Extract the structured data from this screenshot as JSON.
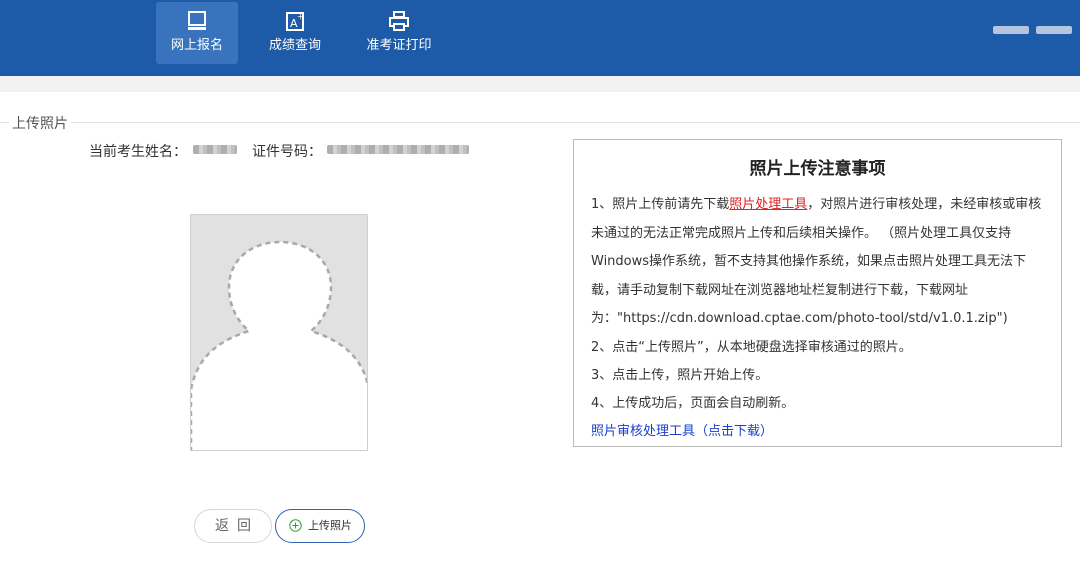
{
  "nav": {
    "items": [
      {
        "label": "网上报名",
        "icon": "monitor-icon",
        "active": true
      },
      {
        "label": "成绩查询",
        "icon": "score-document-icon",
        "active": false
      },
      {
        "label": "准考证打印",
        "icon": "printer-icon",
        "active": false
      }
    ]
  },
  "section": {
    "title": "上传照片"
  },
  "candidate": {
    "name_label": "当前考生姓名：",
    "id_label": "证件号码："
  },
  "photo": {
    "icon": "person-silhouette-icon"
  },
  "notice": {
    "title": "照片上传注意事项",
    "p1_prefix": "1、照片上传前请先下载",
    "p1_link": "照片处理工具",
    "p1_suffix": "，对照片进行审核处理，未经审核或审核未通过的无法正常完成照片上传和后续相关操作。 （照片处理工具仅支持Windows操作系统，暂不支持其他操作系统，如果点击照片处理工具无法下载，请手动复制下载网址在浏览器地址栏复制进行下载，下载网址为：\"https://cdn.download.cptae.com/photo-tool/std/v1.0.1.zip\")",
    "p2": "2、点击“上传照片”，从本地硬盘选择审核通过的照片。",
    "p3": "3、点击上传，照片开始上传。",
    "p4": "4、上传成功后，页面会自动刷新。",
    "download_link": "照片审核处理工具（点击下载）"
  },
  "buttons": {
    "back": "返回",
    "upload": "上传照片"
  },
  "colors": {
    "header": "#1d5aa8",
    "link_red": "#e02020",
    "link_blue": "#1a3fcc"
  }
}
